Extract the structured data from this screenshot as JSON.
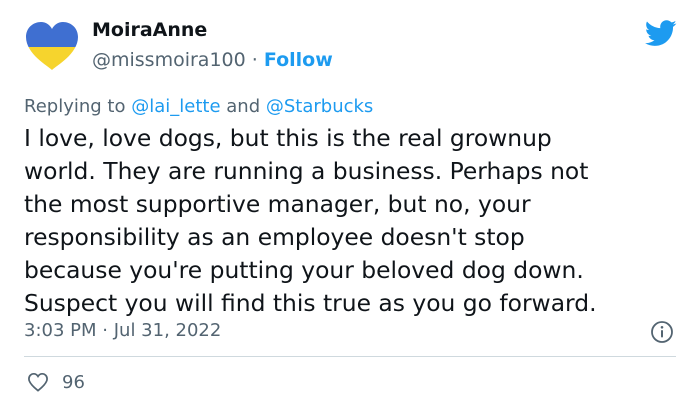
{
  "author": {
    "display_name": "MoiraAnne",
    "handle": "@missmoira100",
    "separator": "·",
    "follow_label": "Follow",
    "avatar_colors": {
      "top": "#3f6fd1",
      "bottom": "#f6d42d"
    }
  },
  "reply_context": {
    "prefix": "Replying to",
    "mention_1": "@lai_lette",
    "joiner": "and",
    "mention_2": "@Starbucks"
  },
  "tweet": {
    "text": "I love, love dogs, but this is the real grownup\nworld.  They are running a business.  Perhaps not\nthe most supportive manager, but no, your\nresponsibility as an employee doesn't stop\nbecause you're putting your beloved dog down.\nSuspect you will find this true as you go forward.",
    "time": "3:03 PM",
    "separator": "·",
    "date": "Jul 31, 2022"
  },
  "stats": {
    "likes": "96"
  },
  "icons": {
    "brand": "twitter-bird-icon",
    "info": "info-icon",
    "like": "heart-icon"
  },
  "colors": {
    "accent": "#1d9bf0",
    "muted_text": "#536471",
    "text": "#0f1419",
    "divider": "#cfd9de"
  }
}
